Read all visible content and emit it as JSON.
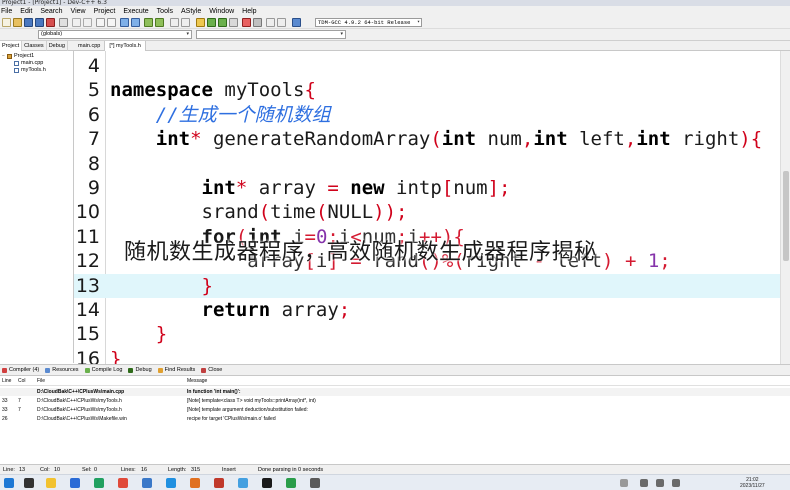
{
  "window": {
    "title": "Project1 - [Project1] - Dev-C++ 6.3"
  },
  "menu": [
    "File",
    "Edit",
    "Search",
    "View",
    "Project",
    "Execute",
    "Tools",
    "AStyle",
    "Window",
    "Help"
  ],
  "toolbar": {
    "compiler": "TDM-GCC 4.9.2 64-bit Release"
  },
  "scope_bar": {
    "class_select": "(globals)",
    "member_select": ""
  },
  "left_panel": {
    "tabs": [
      "Project",
      "Classes",
      "Debug"
    ],
    "tree": {
      "project": "Project1",
      "files": [
        "main.cpp",
        "myTools.h"
      ]
    }
  },
  "editor": {
    "tabs": [
      "main.cpp",
      "[*] myTools.h"
    ],
    "line_numbers": [
      "4",
      "5",
      "6",
      "7",
      "8",
      "9",
      "10",
      "11",
      "12",
      "13",
      "14",
      "15",
      "16"
    ],
    "current_line": "13"
  },
  "overlay": {
    "title": "随机数生成器程序，高效随机数生成器程序揭秘"
  },
  "bottom": {
    "tabs": [
      "Compiler (4)",
      "Resources",
      "Compile Log",
      "Debug",
      "Find Results",
      "Close"
    ],
    "columns": {
      "line": "Line",
      "col": "Col",
      "file": "File",
      "message": "Message"
    },
    "rows": [
      {
        "line": "",
        "col": "",
        "file": "D:\\CloudBak\\C++\\CPlusWs\\main.cpp",
        "message": "In function 'int main()':"
      },
      {
        "line": "33",
        "col": "7",
        "file": "D:\\CloudBak\\C++\\CPlusWs\\myTools.h",
        "message": "[Note] template<class T> void myTools::printArray(int*, int)"
      },
      {
        "line": "33",
        "col": "7",
        "file": "D:\\CloudBak\\C++\\CPlusWs\\myTools.h",
        "message": "[Note] template argument deduction/substitution failed:"
      },
      {
        "line": "26",
        "col": "",
        "file": "D:\\CloudBak\\C++\\CPlusWs\\Makefile.win",
        "message": "recipe for target 'CPlusWs/main.o' failed"
      }
    ]
  },
  "status": {
    "line_label": "Line:",
    "line_value": "13",
    "col_label": "Col:",
    "col_value": "10",
    "sel_label": "Sel:",
    "sel_value": "0",
    "lines_label": "Lines:",
    "lines_value": "16",
    "length_label": "Length:",
    "length_value": "315",
    "mode": "Insert",
    "message": "Done parsing in 0 seconds"
  },
  "taskbar": {
    "time": "21:02",
    "date": "2023/11/27"
  },
  "colors": {
    "keyword": "#000000",
    "operator": "#d0021b",
    "comment": "#2e6fe0",
    "number": "#7a1fa2",
    "current_line_bg": "#e0f6fb"
  }
}
